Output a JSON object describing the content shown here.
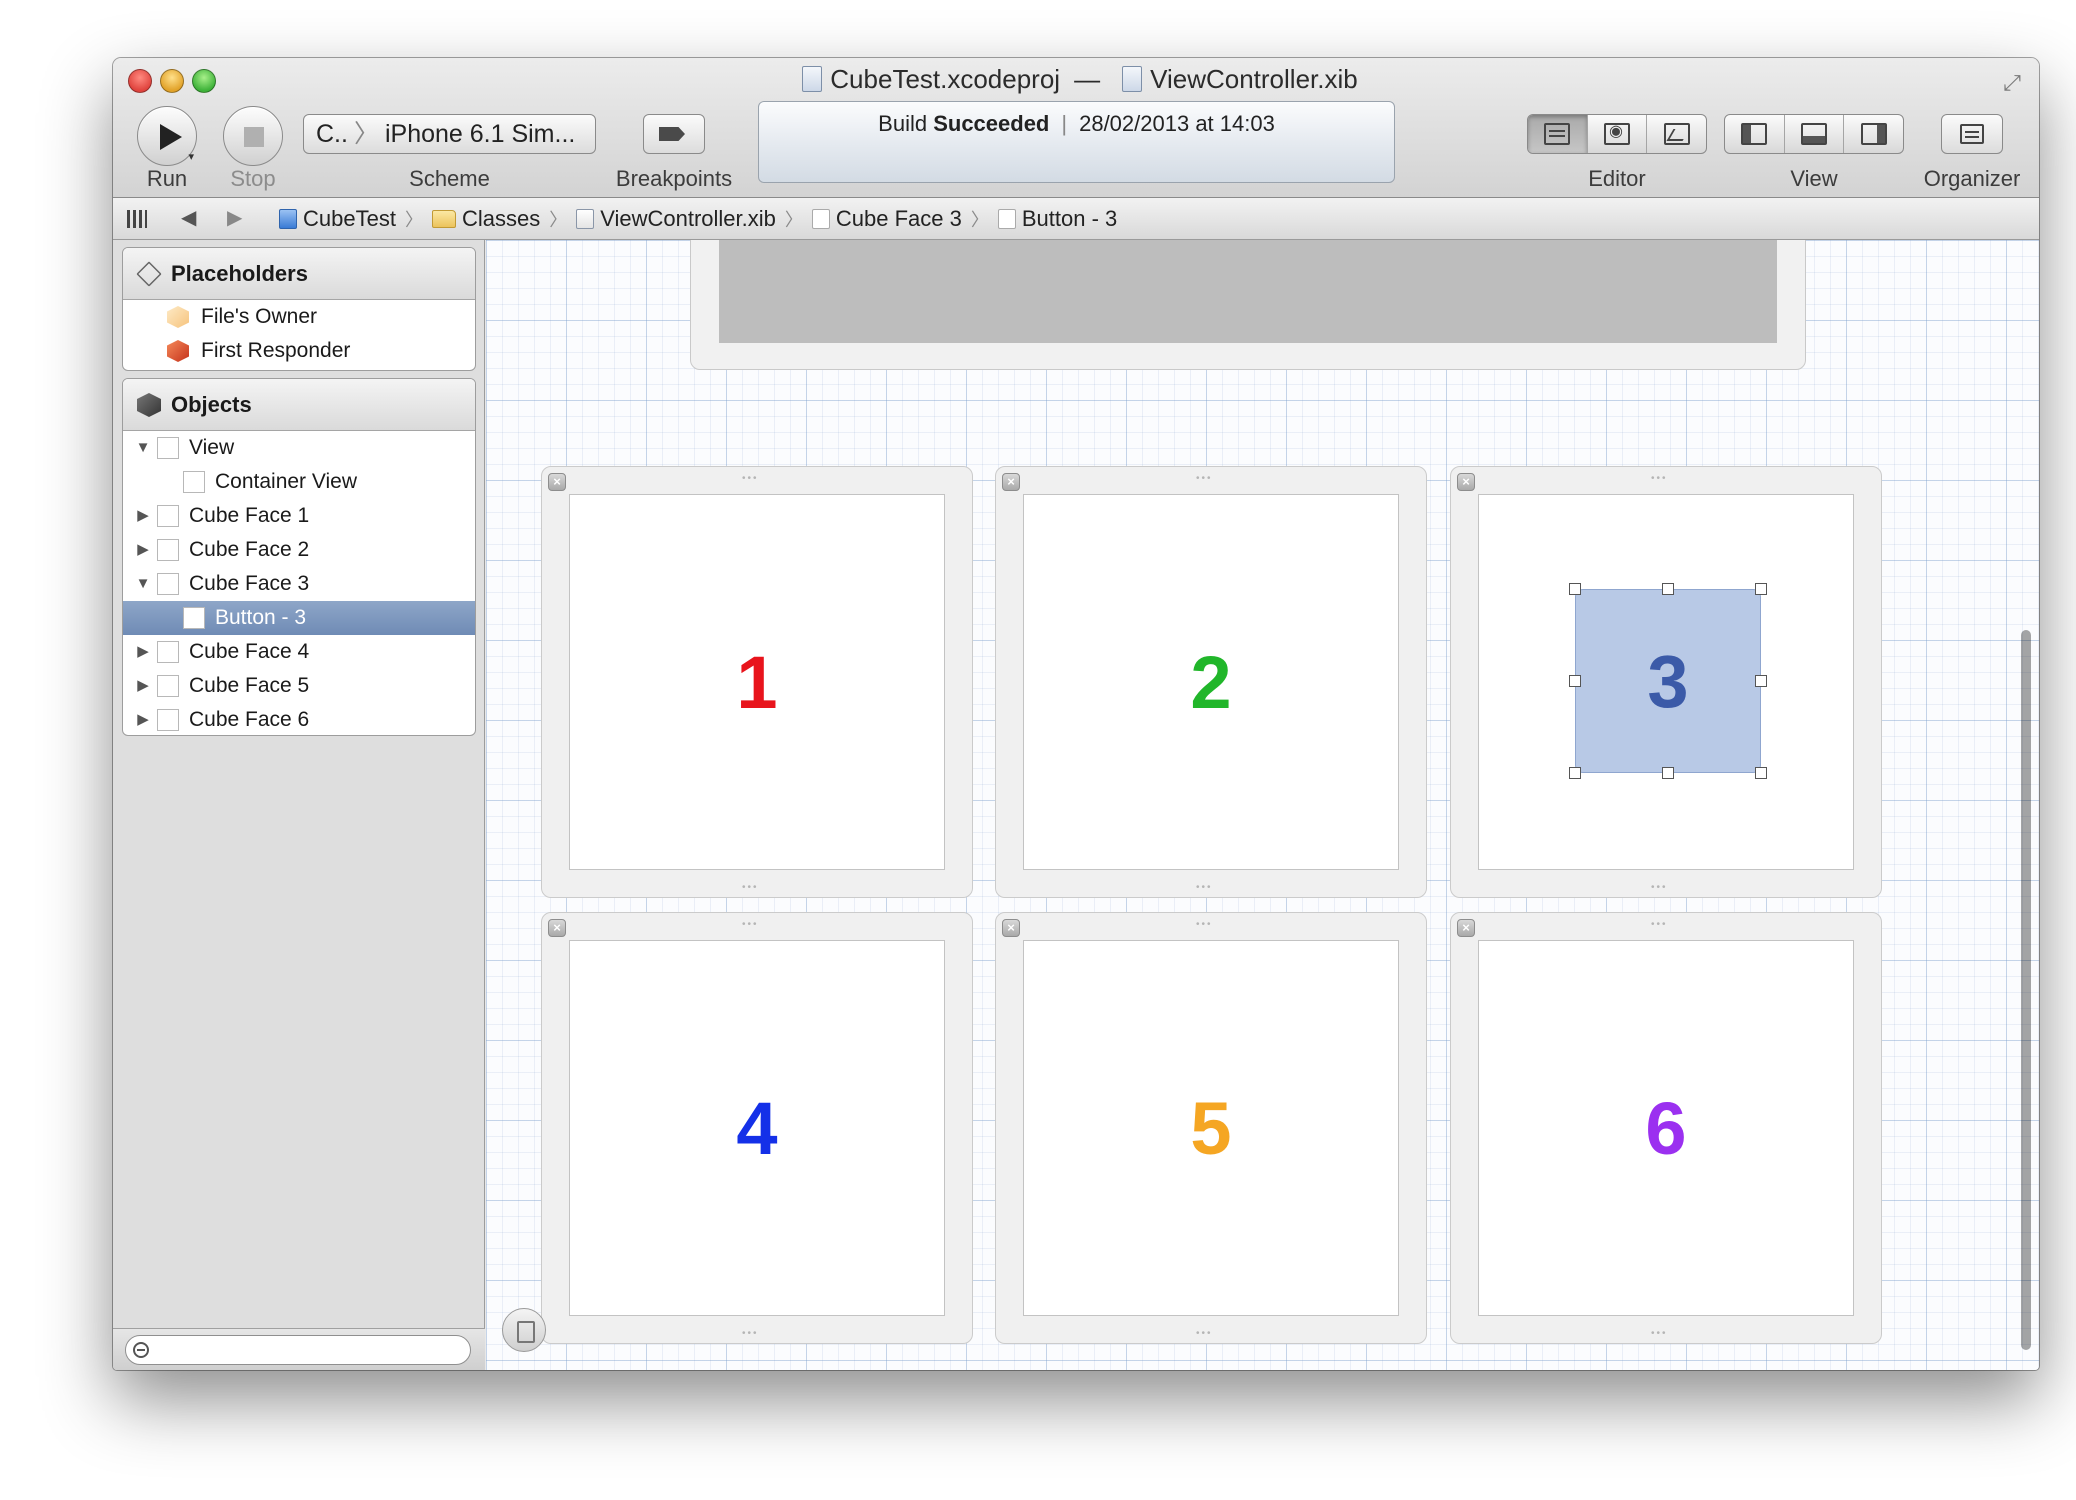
{
  "window": {
    "title_project": "CubeTest.xcodeproj",
    "title_separator": "—",
    "title_file": "ViewController.xib"
  },
  "toolbar": {
    "run_label": "Run",
    "stop_label": "Stop",
    "scheme_target": "C..",
    "scheme_destination": "iPhone 6.1 Sim...",
    "scheme_label": "Scheme",
    "breakpoints_label": "Breakpoints",
    "activity_prefix": "Build ",
    "activity_status": "Succeeded",
    "activity_divider": "|",
    "activity_timestamp": "28/02/2013 at 14:03",
    "editor_label": "Editor",
    "view_label": "View",
    "organizer_label": "Organizer"
  },
  "jumpbar": {
    "crumbs": [
      "CubeTest",
      "Classes",
      "ViewController.xib",
      "Cube Face 3",
      "Button - 3"
    ]
  },
  "outline": {
    "placeholders_header": "Placeholders",
    "placeholders": [
      "File's Owner",
      "First Responder"
    ],
    "objects_header": "Objects",
    "objects": [
      {
        "label": "View",
        "disclosure": "open"
      },
      {
        "label": "Container View",
        "disclosure": "none"
      },
      {
        "label": "Cube Face 1",
        "disclosure": "closed"
      },
      {
        "label": "Cube Face 2",
        "disclosure": "closed"
      },
      {
        "label": "Cube Face 3",
        "disclosure": "open"
      },
      {
        "label": "Button - 3",
        "disclosure": "none",
        "selected": true
      },
      {
        "label": "Cube Face 4",
        "disclosure": "closed"
      },
      {
        "label": "Cube Face 5",
        "disclosure": "closed"
      },
      {
        "label": "Cube Face 6",
        "disclosure": "closed"
      }
    ]
  },
  "canvas": {
    "faces": [
      {
        "number": "1",
        "color": "#e8141c"
      },
      {
        "number": "2",
        "color": "#21b62a"
      },
      {
        "number": "3",
        "color": "#3b5aa8",
        "selected": true
      },
      {
        "number": "4",
        "color": "#1430e8"
      },
      {
        "number": "5",
        "color": "#f5a623"
      },
      {
        "number": "6",
        "color": "#9b30f0"
      }
    ]
  },
  "colors": {
    "selection_row": "#7f98bf",
    "selected_button_fill": "#b8c9e6",
    "grid_line": "#7da0cd"
  }
}
